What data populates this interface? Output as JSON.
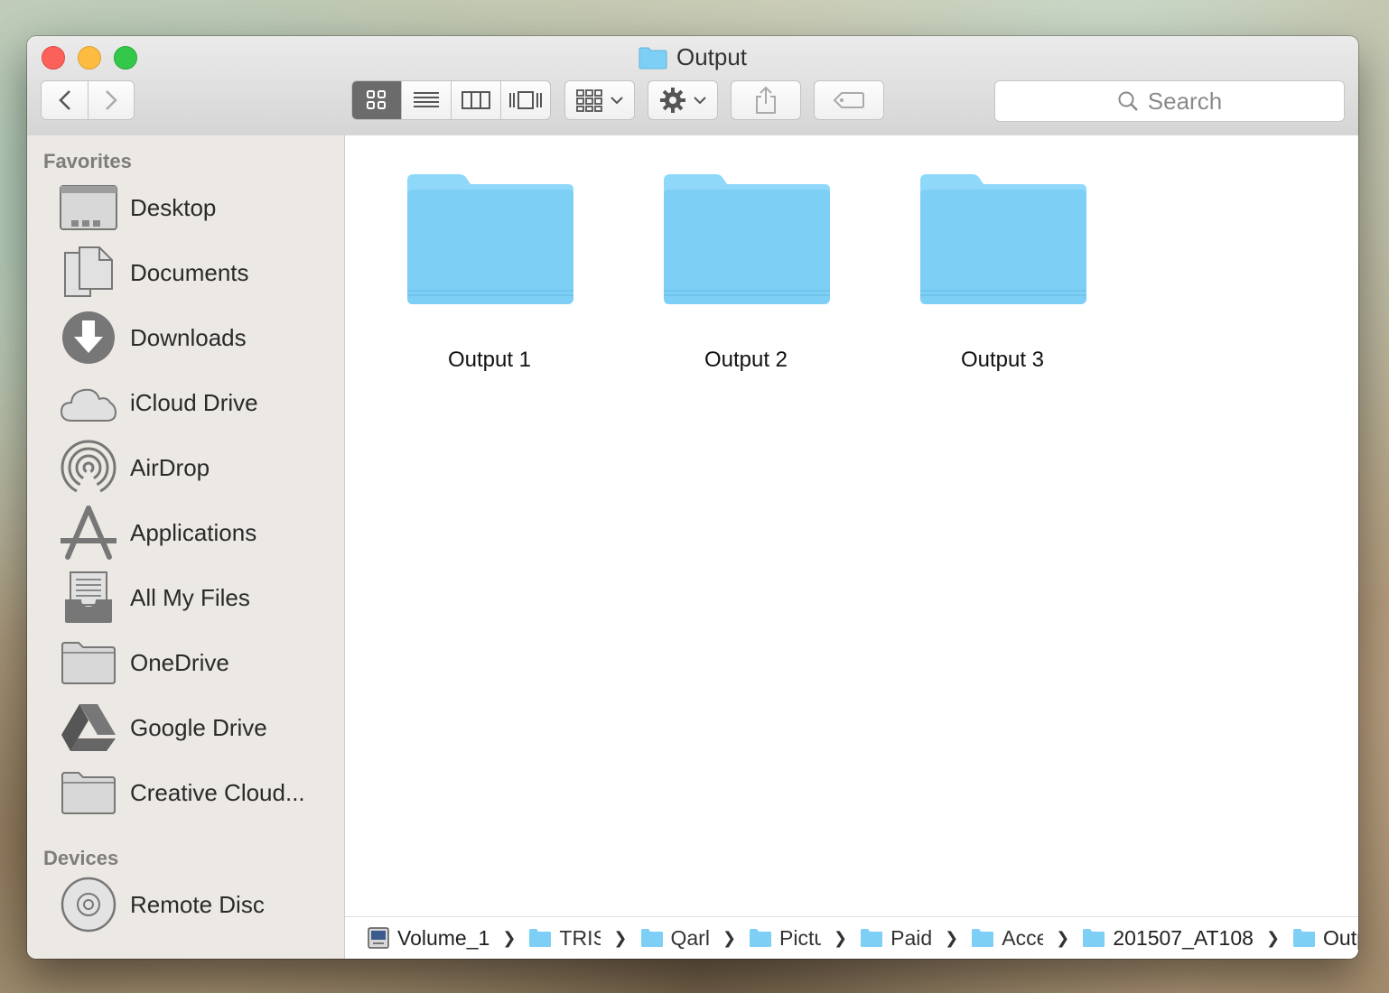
{
  "window": {
    "title": "Output"
  },
  "sidebar": {
    "favorites_title": "Favorites",
    "favorites": [
      {
        "label": "Desktop",
        "icon": "desktop-icon"
      },
      {
        "label": "Documents",
        "icon": "documents-icon"
      },
      {
        "label": "Downloads",
        "icon": "downloads-icon"
      },
      {
        "label": "iCloud Drive",
        "icon": "icloud-icon"
      },
      {
        "label": "AirDrop",
        "icon": "airdrop-icon"
      },
      {
        "label": "Applications",
        "icon": "applications-icon"
      },
      {
        "label": "All My Files",
        "icon": "all-files-icon"
      },
      {
        "label": "OneDrive",
        "icon": "folder-icon"
      },
      {
        "label": "Google Drive",
        "icon": "google-drive-icon"
      },
      {
        "label": "Creative Cloud...",
        "icon": "folder-icon"
      }
    ],
    "devices_title": "Devices",
    "devices": [
      {
        "label": "Remote Disc",
        "icon": "disc-icon"
      }
    ]
  },
  "toolbar": {
    "search_placeholder": "Search"
  },
  "items": [
    {
      "label": "Output 1"
    },
    {
      "label": "Output 2"
    },
    {
      "label": "Output 3"
    }
  ],
  "pathbar": {
    "root": "Volume_1",
    "crumbs": [
      "TRIS",
      "Qarl",
      "Pictu",
      "Paid",
      "Acce",
      "201507_AT108",
      "Output"
    ]
  },
  "colors": {
    "folder_blue": "#7ecff5",
    "sidebar_bg": "#ece8e3",
    "active_view_bg": "#6b6b6b"
  }
}
